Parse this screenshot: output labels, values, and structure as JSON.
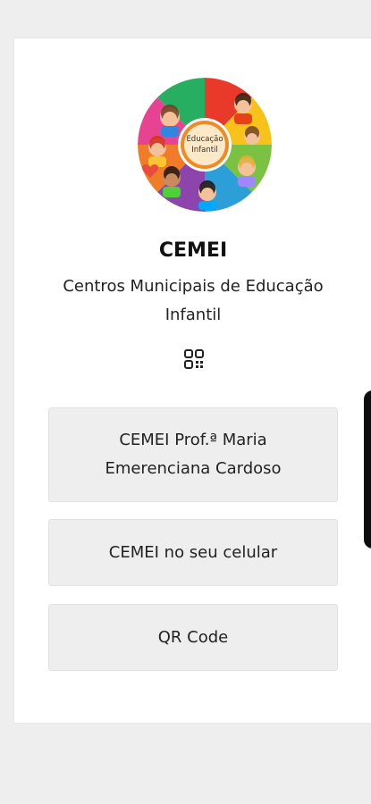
{
  "app": {
    "title": "CEMEI",
    "subtitle": "Centros Municipais de Educação Infantil"
  },
  "logo": {
    "text_line1": "Educação",
    "text_line2": "Infantil"
  },
  "icons": {
    "qr": "qr-code-icon"
  },
  "buttons": [
    {
      "label": "CEMEI Prof.ª Maria Emerenciana Cardoso"
    },
    {
      "label": "CEMEI no seu celular"
    },
    {
      "label": "QR Code"
    }
  ],
  "colors": {
    "page_bg": "#eeeeee",
    "card_bg": "#ffffff",
    "button_bg": "#eeeeee",
    "logo_center": "#f08a24"
  }
}
